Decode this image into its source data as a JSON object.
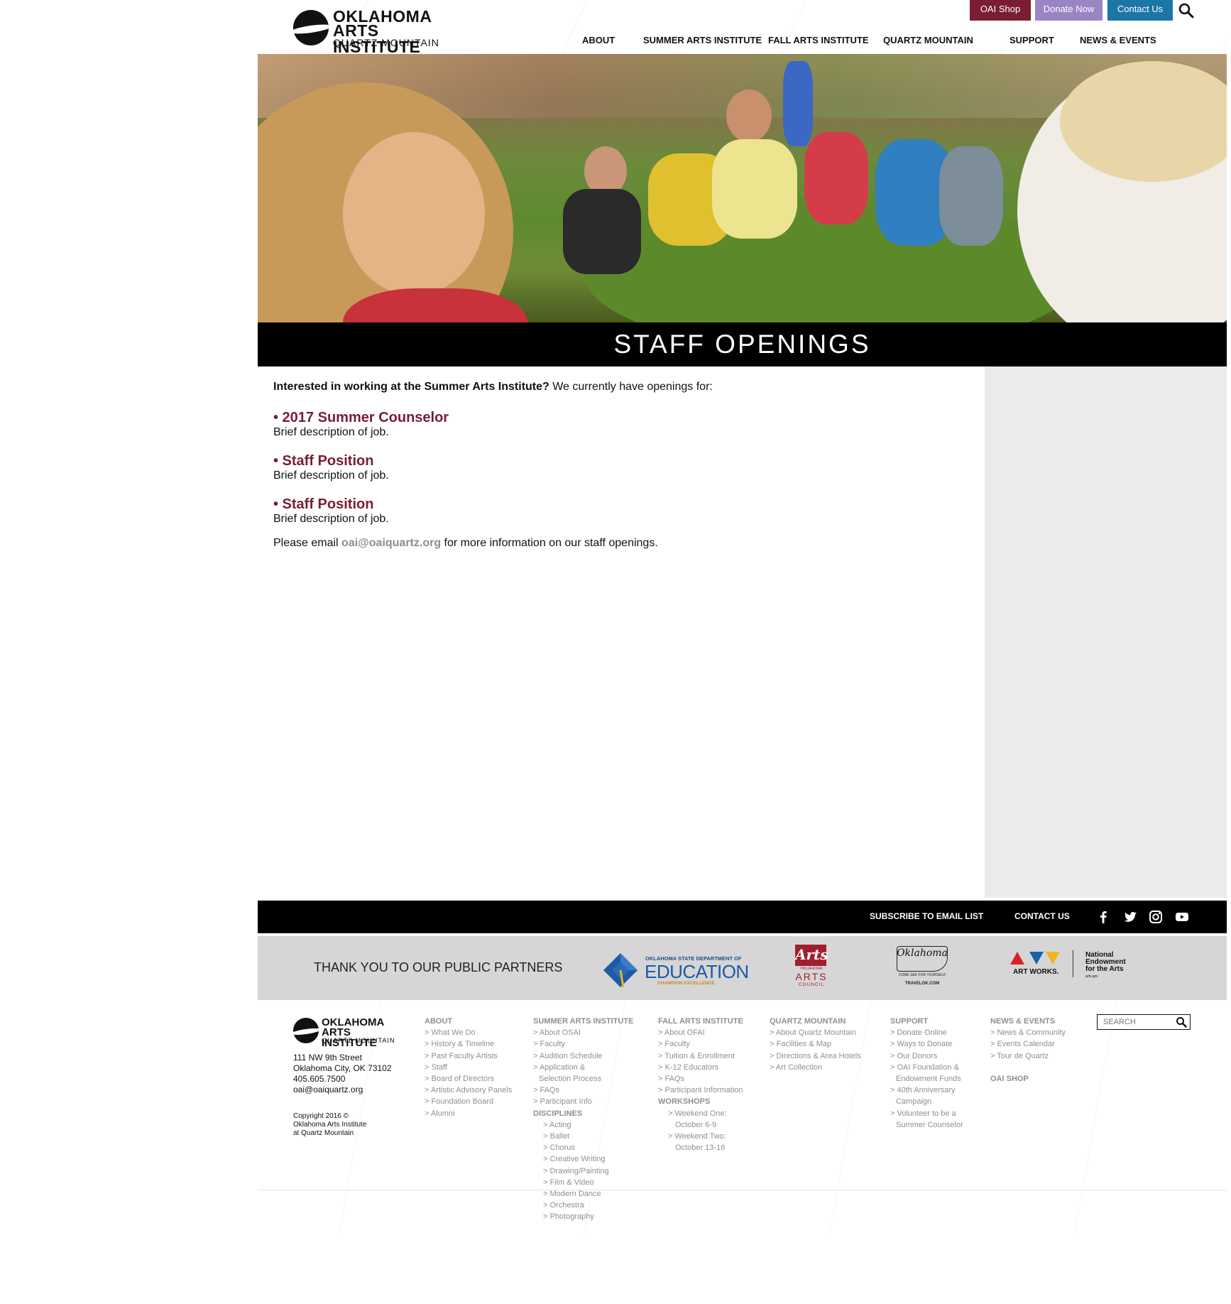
{
  "header": {
    "logo": {
      "line1": "OKLAHOMA",
      "line2": "ARTS INSTITUTE",
      "line3": "QUARTZ MOUNTAIN"
    },
    "top_buttons": {
      "shop": "OAI Shop",
      "donate": "Donate Now",
      "contact": "Contact Us"
    },
    "colors": {
      "shop": "#7a1d33",
      "donate": "#9b84c4",
      "contact": "#1b76a6"
    },
    "search_icon": "search-icon",
    "nav": [
      "ABOUT",
      "SUMMER ARTS INSTITUTE",
      "FALL ARTS INSTITUTE",
      "QUARTZ MOUNTAIN",
      "SUPPORT",
      "NEWS & EVENTS"
    ]
  },
  "hero": {
    "title": "STAFF OPENINGS"
  },
  "content": {
    "intro_bold": "Interested in working at the Summer Arts Institute?",
    "intro_rest": " We currently have openings for:",
    "jobs": [
      {
        "title": "• 2017 Summer Counselor",
        "desc": "Brief description of job."
      },
      {
        "title": "• Staff Position",
        "desc": "Brief description of job."
      },
      {
        "title": "• Staff Position",
        "desc": "Brief description of job."
      }
    ],
    "email_pre": "Please email ",
    "email": "oai@oaiquartz.org",
    "email_post": " for more information on our staff openings.",
    "accent_color": "#7a1d33"
  },
  "footer_bar": {
    "subscribe": "SUBSCRIBE TO EMAIL LIST",
    "contact": "CONTACT US",
    "social_icons": [
      "facebook-icon",
      "twitter-icon",
      "instagram-icon",
      "youtube-icon"
    ]
  },
  "partners": {
    "title": "THANK YOU TO OUR PUBLIC PARTNERS",
    "education": {
      "top": "OKLAHOMA STATE DEPARTMENT OF",
      "main": "EDUCATION",
      "tag": "CHAMPION EXCELLENCE"
    },
    "arts_council": {
      "script": "Arts",
      "main": "ARTS",
      "sub": "OKLAHOMA",
      "bottom": "COUNCIL"
    },
    "travel": {
      "script": "Oklahoma",
      "tag": "COME SEE FOR YOURSELF",
      "url": "TRAVELOK.COM"
    },
    "nea": {
      "artworks": "ART WORKS.",
      "line1": "National",
      "line2": "Endowment",
      "line3": "for the Arts",
      "url": "arts.gov"
    }
  },
  "footer": {
    "logo": {
      "line1": "OKLAHOMA",
      "line2": "ARTS INSTITUTE",
      "line3": "QUARTZ MOUNTAIN"
    },
    "address": [
      "111 NW 9th Street",
      "Oklahoma City, OK 73102",
      "405.605.7500",
      "oai@oaiquartz.org"
    ],
    "copyright": [
      "Copyright 2016 ©",
      "Oklahoma Arts Institute",
      "at Quartz Mountain"
    ],
    "about": {
      "heading": "ABOUT",
      "items": [
        "> What We Do",
        "> History & Timeline",
        "> Past Faculty Artists",
        "> Staff",
        "> Board of Directors",
        "> Artistic Advisory Panels",
        "> Foundation Board",
        "> Alumni"
      ]
    },
    "summer": {
      "heading": "SUMMER ARTS INSTITUTE",
      "items": [
        "> About OSAI",
        "> Faculty",
        "> Audition Schedule",
        "> Application &",
        "Selection Process",
        "> FAQs",
        "> Participant Info"
      ],
      "disc_heading": "DISCIPLINES",
      "disciplines": [
        "> Acting",
        "> Ballet",
        "> Chorus",
        "> Creative Writing",
        "> Drawing/Painting",
        "> Film & Video",
        "> Modern Dance",
        "> Orchestra",
        "> Photography"
      ]
    },
    "fall": {
      "heading": "FALL ARTS INSTITUTE",
      "items": [
        "> About OFAI",
        "> Faculty",
        "> Tuition & Enrollment",
        "> K-12 Educators",
        "> FAQs",
        "> Participant Information"
      ],
      "work_heading": "WORKSHOPS",
      "workshops": [
        "> Weekend One:",
        "October 6-9",
        "> Weekend Two:",
        "October 13-16"
      ]
    },
    "quartz": {
      "heading": "QUARTZ MOUNTAIN",
      "items": [
        "> About Quartz Mountain",
        "> Facilities & Map",
        "> Directions & Area Hotels",
        "> Art Collection"
      ]
    },
    "support": {
      "heading": "SUPPORT",
      "items": [
        "> Donate Online",
        "> Ways to Donate",
        "> Our Donors",
        "> OAI Foundation &",
        "Endowment Funds",
        "> 40th Anniversary",
        "Campaign",
        "> Volunteer to be a",
        "Summer Counselor"
      ]
    },
    "news": {
      "heading": "NEWS & EVENTS",
      "items": [
        "> News & Community",
        "> Events Calendar",
        "> Tour de Quartz"
      ],
      "shop": "OAI SHOP"
    },
    "search_placeholder": "SEARCH"
  }
}
